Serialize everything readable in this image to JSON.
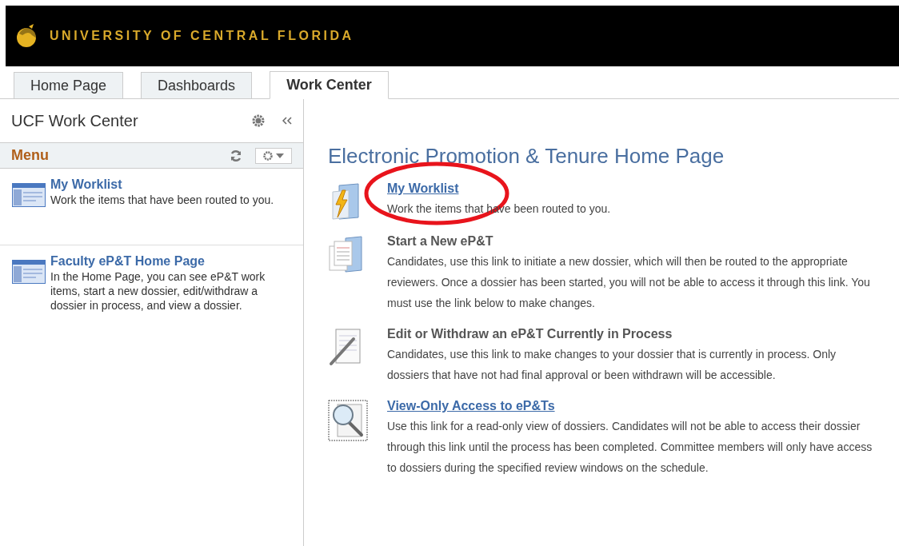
{
  "header": {
    "brand": "UNIVERSITY OF CENTRAL FLORIDA"
  },
  "tabs": [
    {
      "label": "Home Page",
      "selected": false
    },
    {
      "label": "Dashboards",
      "selected": false
    },
    {
      "label": "Work Center",
      "selected": true
    }
  ],
  "sidebar": {
    "title": "UCF Work Center",
    "menu_label": "Menu",
    "items": [
      {
        "title": "My Worklist",
        "description": "Work the items that have been routed to you."
      },
      {
        "title": "Faculty eP&T Home Page",
        "description": "In the Home Page, you can see eP&T work items, start a new dossier, edit/withdraw a dossier in process, and view a dossier."
      }
    ]
  },
  "main": {
    "title": "Electronic Promotion & Tenure Home Page",
    "items": [
      {
        "kind": "link",
        "title": "My Worklist",
        "description": "Work the items that have been routed to you.",
        "circled": true
      },
      {
        "kind": "plain",
        "title": "Start a New eP&T",
        "description": "Candidates, use this link to initiate a new dossier, which will then be routed to the appropriate reviewers. Once a dossier has been started, you will not be able to access it through this link. You must use the link below to make changes.",
        "circled": false
      },
      {
        "kind": "plain",
        "title": "Edit or Withdraw an eP&T Currently in Process",
        "description": "Candidates, use this link to make changes to your dossier that is currently in process. Only dossiers that have not had final approval or been withdrawn will be accessible.",
        "circled": false
      },
      {
        "kind": "link",
        "title": "View-Only Access to eP&Ts",
        "description": "Use this link for a read-only view of dossiers. Candidates will not be able to access their dossier through this link until the process has been completed. Committee members will only have access to dossiers during the specified review windows on the schedule.",
        "circled": false
      }
    ]
  }
}
